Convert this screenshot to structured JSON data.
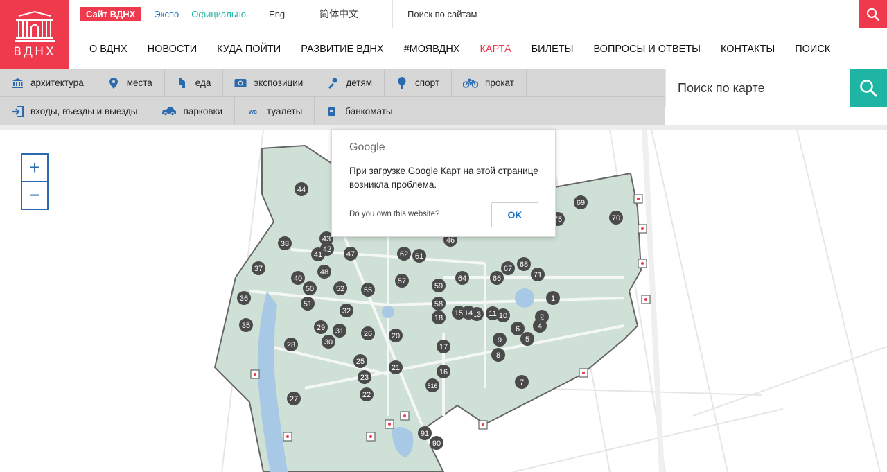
{
  "logo": {
    "text": "ВДНХ"
  },
  "topbar": {
    "site_label": "Сайт ВДНХ",
    "expo": "Экспо",
    "official": "Официально",
    "eng": "Eng",
    "chinese": "简体中文",
    "site_search_placeholder": "Поиск по сайтам"
  },
  "mainnav": {
    "items": [
      {
        "label": "О ВДНХ",
        "active": false
      },
      {
        "label": "НОВОСТИ",
        "active": false
      },
      {
        "label": "КУДА ПОЙТИ",
        "active": false
      },
      {
        "label": "РАЗВИТИЕ ВДНХ",
        "active": false
      },
      {
        "label": "#МОЯВДНХ",
        "active": false
      },
      {
        "label": "КАРТА",
        "active": true
      },
      {
        "label": "БИЛЕТЫ",
        "active": false
      },
      {
        "label": "ВОПРОСЫ И ОТВЕТЫ",
        "active": false
      },
      {
        "label": "КОНТАКТЫ",
        "active": false
      },
      {
        "label": "ПОИСК",
        "active": false
      }
    ]
  },
  "filters": {
    "row1": [
      {
        "label": "архитектура",
        "icon": "museum-icon"
      },
      {
        "label": "места",
        "icon": "map-pin-icon"
      },
      {
        "label": "еда",
        "icon": "food-icon"
      },
      {
        "label": "экспозиции",
        "icon": "exhibition-icon"
      },
      {
        "label": "детям",
        "icon": "kids-icon"
      },
      {
        "label": "спорт",
        "icon": "sport-icon"
      },
      {
        "label": "прокат",
        "icon": "bicycle-icon"
      }
    ],
    "row2": [
      {
        "label": "входы, въезды и выезды",
        "icon": "entrance-icon"
      },
      {
        "label": "парковки",
        "icon": "car-icon"
      },
      {
        "label": "туалеты",
        "icon": "wc-icon"
      },
      {
        "label": "банкоматы",
        "icon": "atm-icon"
      }
    ]
  },
  "map_search": {
    "placeholder": "Поиск по карте"
  },
  "zoom": {
    "plus": "+",
    "minus": "−"
  },
  "google_dialog": {
    "logo": "Google",
    "message": "При загрузке Google Карт на этой странице возникла проблема.",
    "own_site": "Do you own this website?",
    "ok": "OK"
  },
  "map_markers": [
    "1",
    "2",
    "4",
    "5",
    "6",
    "7",
    "8",
    "9",
    "10",
    "11",
    "13",
    "14",
    "15",
    "16",
    "17",
    "18",
    "20",
    "21",
    "22",
    "23",
    "25",
    "26",
    "27",
    "28",
    "29",
    "30",
    "31",
    "32",
    "35",
    "36",
    "37",
    "38",
    "40",
    "41",
    "42",
    "43",
    "44",
    "46",
    "47",
    "48",
    "50",
    "51",
    "52",
    "55",
    "57",
    "58",
    "59",
    "61",
    "62",
    "64",
    "66",
    "67",
    "68",
    "69",
    "70",
    "71",
    "75",
    "90",
    "91",
    "516"
  ],
  "colors": {
    "brand_red": "#ef3a4d",
    "teal": "#1fb5a4",
    "blue": "#2a6bb0",
    "park_green": "#cfe0d6",
    "marker": "#4a4a4a"
  }
}
